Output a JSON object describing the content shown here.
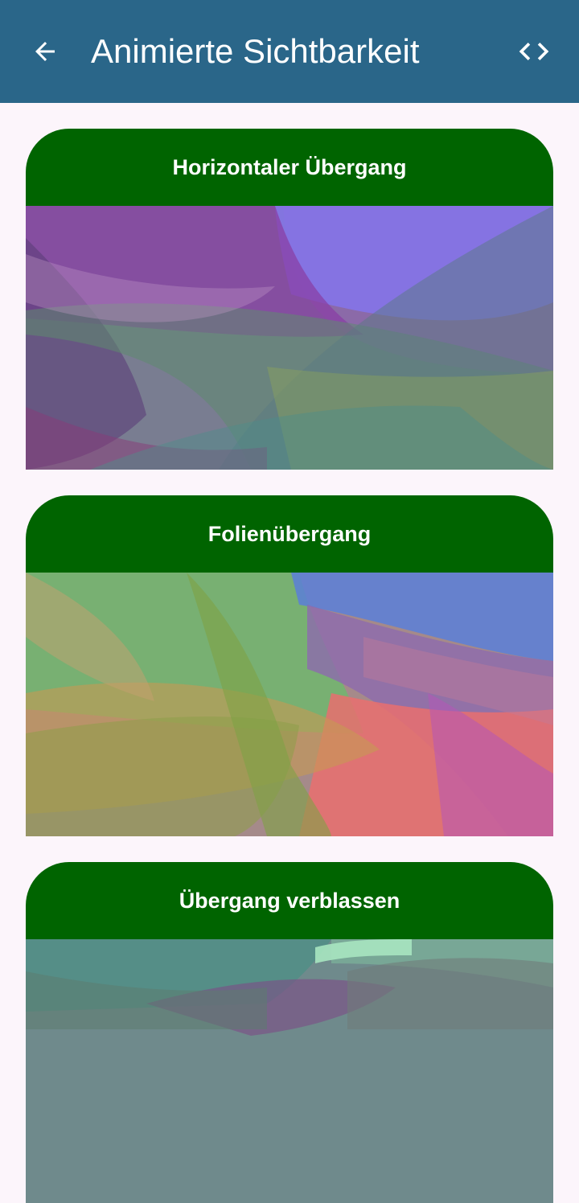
{
  "appbar": {
    "title": "Animierte Sichtbarkeit",
    "back_icon": "arrow-left-icon",
    "code_icon": "code-brackets-icon",
    "background": "#2A6689"
  },
  "cards": [
    {
      "title": "Horizontaler Übergang",
      "header_color": "#006400",
      "artwork": "abstract-wave-purple-green"
    },
    {
      "title": "Folienübergang",
      "header_color": "#006400",
      "artwork": "abstract-wave-green-red"
    },
    {
      "title": "Übergang verblassen",
      "header_color": "#006400",
      "artwork": "abstract-wave-teal-magenta"
    }
  ]
}
